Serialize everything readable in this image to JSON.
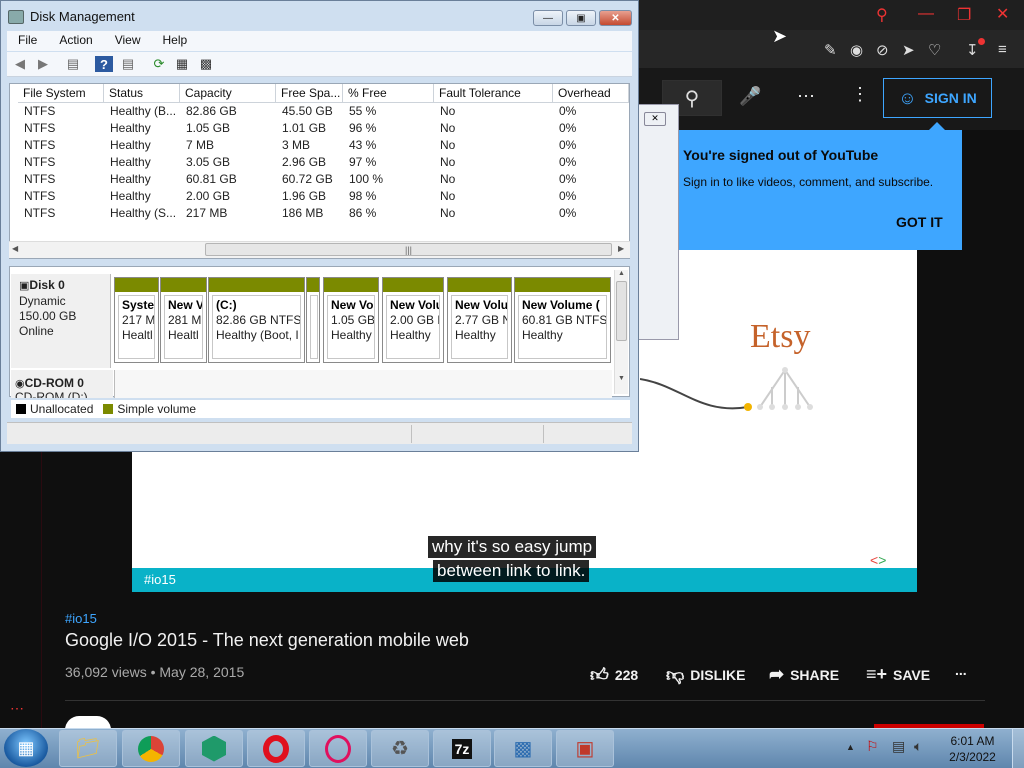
{
  "browser": {
    "window_controls": [
      "search-icon",
      "minimize-icon",
      "restore-icon",
      "close-icon"
    ],
    "toolbar_icons": [
      "edit-icon",
      "camera-icon",
      "block-icon",
      "send-icon",
      "heart-icon",
      "download-icon",
      "menu-icon"
    ]
  },
  "youtube": {
    "sign_in_label": "SIGN IN",
    "popup": {
      "title": "You're signed out of YouTube",
      "body": "Sign in to like videos, comment, and subscribe.",
      "button": "GOT IT"
    },
    "video": {
      "brand_text": "Etsy",
      "hashtag_overlay": "#io15",
      "caption_line1": "why it's so easy jump",
      "caption_line2": "between link to link.",
      "tag": "#io15",
      "title": "Google I/O 2015 - The next generation mobile web",
      "stats": "36,092 views • May 28, 2015",
      "likes": "228",
      "dislike_label": "DISLIKE",
      "share_label": "SHARE",
      "save_label": "SAVE",
      "more": "..."
    }
  },
  "disk_management": {
    "title": "Disk Management",
    "window_buttons": [
      "minimize",
      "maximize",
      "close"
    ],
    "menu": [
      "File",
      "Action",
      "View",
      "Help"
    ],
    "columns": [
      "File System",
      "Status",
      "Capacity",
      "Free Spa...",
      "% Free",
      "Fault Tolerance",
      "Overhead"
    ],
    "rows": [
      [
        "NTFS",
        "Healthy (B...",
        "82.86 GB",
        "45.50 GB",
        "55 %",
        "No",
        "0%"
      ],
      [
        "NTFS",
        "Healthy",
        "1.05 GB",
        "1.01 GB",
        "96 %",
        "No",
        "0%"
      ],
      [
        "NTFS",
        "Healthy",
        "7 MB",
        "3 MB",
        "43 %",
        "No",
        "0%"
      ],
      [
        "NTFS",
        "Healthy",
        "3.05 GB",
        "2.96 GB",
        "97 %",
        "No",
        "0%"
      ],
      [
        "NTFS",
        "Healthy",
        "60.81 GB",
        "60.72 GB",
        "100 %",
        "No",
        "0%"
      ],
      [
        "NTFS",
        "Healthy",
        "2.00 GB",
        "1.96 GB",
        "98 %",
        "No",
        "0%"
      ],
      [
        "NTFS",
        "Healthy (S...",
        "217 MB",
        "186 MB",
        "86 %",
        "No",
        "0%"
      ]
    ],
    "disk0": {
      "name": "Disk 0",
      "type": "Dynamic",
      "size": "150.00 GB",
      "state": "Online"
    },
    "cdrom": {
      "name": "CD-ROM 0",
      "sub": "CD-ROM (D:)"
    },
    "partitions": [
      {
        "name": "Syste",
        "size": "217 M",
        "status": "Healtl"
      },
      {
        "name": "New V",
        "size": "281 M",
        "status": "Healtl"
      },
      {
        "name": "(C:)",
        "size": "82.86 GB NTFS",
        "status": "Healthy (Boot, I"
      },
      {
        "name": "",
        "size": "",
        "status": ""
      },
      {
        "name": "New Vo",
        "size": "1.05 GB",
        "status": "Healthy"
      },
      {
        "name": "New Volu",
        "size": "2.00 GB N",
        "status": "Healthy"
      },
      {
        "name": "New Volu",
        "size": "2.77 GB N",
        "status": "Healthy"
      },
      {
        "name": "New Volume (",
        "size": "60.81 GB NTFS",
        "status": "Healthy"
      }
    ],
    "legend": {
      "unallocated": "Unallocated",
      "simple": "Simple volume",
      "unallocated_color": "#000000",
      "simple_color": "#7b8a00"
    }
  },
  "taskbar": {
    "apps": [
      "explorer",
      "chrome",
      "app-green",
      "opera",
      "opera-gx",
      "recycle-bin",
      "7zip",
      "control-panel",
      "toolbox"
    ],
    "time": "6:01 AM",
    "date": "2/3/2022"
  }
}
